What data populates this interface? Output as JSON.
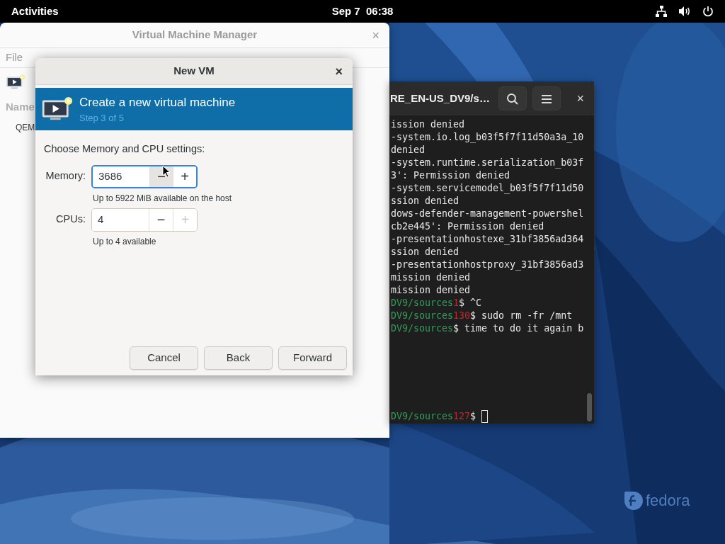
{
  "top_bar": {
    "activities": "Activities",
    "clock": "Sep 7  06:38"
  },
  "desktop": {
    "logo": "fedora"
  },
  "vmm_window": {
    "title": "Virtual Machine Manager",
    "close": "×",
    "menu": [
      "File"
    ],
    "column_header": "Name",
    "row": "QEM"
  },
  "terminal": {
    "title": "RE_EN-US_DV9/s…",
    "close": "×",
    "lines": [
      [
        {
          "kind": "text",
          "text": "ission denied"
        }
      ],
      [
        {
          "kind": "text",
          "text": "-system.io.log_b03f5f7f11d50a3a_10"
        }
      ],
      [
        {
          "kind": "text",
          "text": "denied"
        }
      ],
      [
        {
          "kind": "text",
          "text": "-system.runtime.serialization_b03f"
        }
      ],
      [
        {
          "kind": "text",
          "text": "3': Permission denied"
        }
      ],
      [
        {
          "kind": "text",
          "text": "-system.servicemodel_b03f5f7f11d50"
        }
      ],
      [
        {
          "kind": "text",
          "text": "ssion denied"
        }
      ],
      [
        {
          "kind": "text",
          "text": "dows-defender-management-powershel"
        }
      ],
      [
        {
          "kind": "text",
          "text": "cb2e445': Permission denied"
        }
      ],
      [
        {
          "kind": "text",
          "text": "-presentationhostexe_31bf3856ad364"
        }
      ],
      [
        {
          "kind": "text",
          "text": "ssion denied"
        }
      ],
      [
        {
          "kind": "text",
          "text": "-presentationhostproxy_31bf3856ad3"
        }
      ],
      [
        {
          "kind": "text",
          "text": "mission denied"
        }
      ],
      [
        {
          "kind": "text",
          "text": "mission denied"
        }
      ],
      [
        {
          "kind": "path",
          "text": "DV9/sources"
        },
        {
          "kind": "status",
          "text": "1"
        },
        {
          "kind": "text",
          "text": "$ ^C"
        }
      ],
      [
        {
          "kind": "path",
          "text": "DV9/sources"
        },
        {
          "kind": "status",
          "text": "130"
        },
        {
          "kind": "text",
          "text": "$ sudo rm -fr /mnt"
        }
      ],
      [
        {
          "kind": "path",
          "text": "DV9/sources"
        },
        {
          "kind": "text",
          "text": "$ time to do it again b"
        }
      ]
    ],
    "prompt_line": [
      {
        "kind": "path",
        "text": "DV9/sources"
      },
      {
        "kind": "status",
        "text": "127"
      },
      {
        "kind": "text",
        "text": "$ "
      },
      {
        "kind": "cursor"
      }
    ]
  },
  "dialog": {
    "title": "New VM",
    "close": "×",
    "header": {
      "title": "Create a new virtual machine",
      "step": "Step 3 of 5"
    },
    "prompt": "Choose Memory and CPU settings:",
    "fields": [
      {
        "label": "Memory:",
        "value": "3686",
        "focused": true,
        "minus": {
          "text": "−",
          "disabled": false,
          "hovered": true
        },
        "plus": {
          "text": "+",
          "disabled": false,
          "hovered": false
        },
        "hint": "Up to 5922 MiB available on the host"
      },
      {
        "label": "CPUs:",
        "value": "4",
        "focused": false,
        "minus": {
          "text": "−",
          "disabled": false,
          "hovered": false
        },
        "plus": {
          "text": "+",
          "disabled": true,
          "hovered": false
        },
        "hint": "Up to 4 available"
      }
    ],
    "buttons": [
      "Cancel",
      "Back",
      "Forward"
    ]
  }
}
